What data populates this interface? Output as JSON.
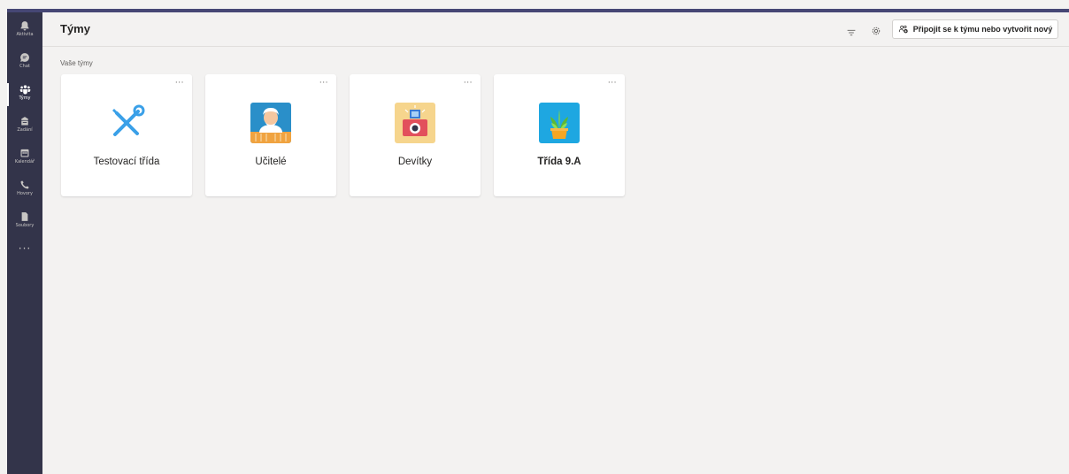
{
  "rail": {
    "items": [
      {
        "label": "Aktivita",
        "icon": "bell-icon"
      },
      {
        "label": "Chat",
        "icon": "chat-icon"
      },
      {
        "label": "Týmy",
        "icon": "teams-icon"
      },
      {
        "label": "Zadání",
        "icon": "assignments-icon"
      },
      {
        "label": "Kalendář",
        "icon": "calendar-icon"
      },
      {
        "label": "Hovory",
        "icon": "phone-icon"
      },
      {
        "label": "Soubory",
        "icon": "file-icon"
      }
    ],
    "more": "···",
    "active_index": 2
  },
  "header": {
    "title": "Týmy",
    "join_label": "Připojit se k týmu nebo vytvořit nový"
  },
  "section": {
    "label": "Vaše týmy"
  },
  "teams": [
    {
      "name": "Testovací třída",
      "bold": false,
      "icon": "tools-icon"
    },
    {
      "name": "Učitelé",
      "bold": false,
      "icon": "teacher-avatar-icon"
    },
    {
      "name": "Devítky",
      "bold": false,
      "icon": "camera-icon"
    },
    {
      "name": "Třída 9.A",
      "bold": true,
      "icon": "plant-icon"
    }
  ],
  "more_glyph": "···",
  "colors": {
    "rail": "#33344a",
    "accent": "#464775",
    "background": "#f3f2f1"
  }
}
